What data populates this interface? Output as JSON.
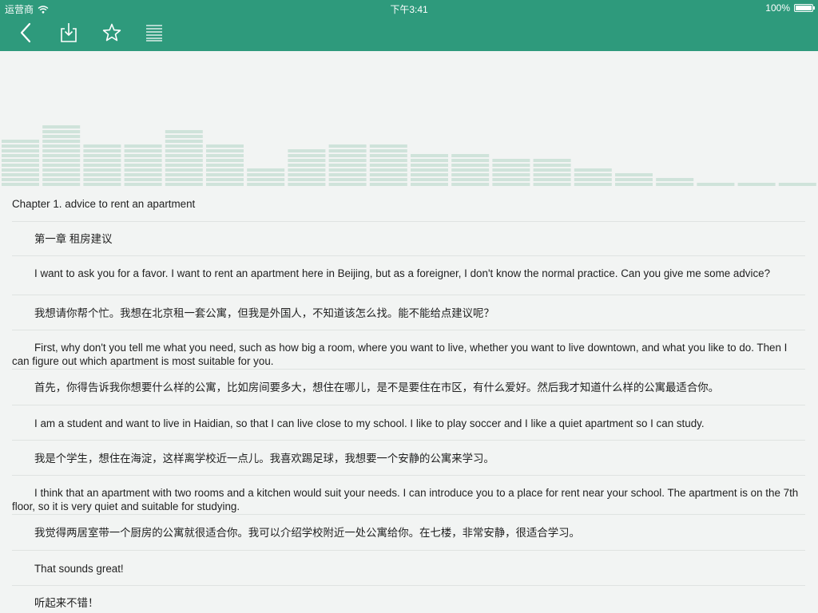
{
  "status_bar": {
    "carrier": "运营商",
    "time": "下午3:41",
    "battery": "100%"
  },
  "toolbar": {
    "back_icon": "back-chevron-icon",
    "download_icon": "download-icon",
    "favorite_icon": "star-icon",
    "menu_icon": "list-icon",
    "accent_color": "#2e9a7c"
  },
  "visualizer": {
    "levels": [
      0.36,
      0.46,
      0.32,
      0.32,
      0.43,
      0.32,
      0.13,
      0.28,
      0.32,
      0.32,
      0.24,
      0.24,
      0.2,
      0.2,
      0.13,
      0.1,
      0.06,
      0.03,
      0.03,
      0.03
    ],
    "color": "#cfe3da"
  },
  "content": {
    "lines": [
      {
        "type": "chapter",
        "text": "Chapter 1. advice to rent an apartment"
      },
      {
        "type": "zh",
        "text": "第一章 租房建议"
      },
      {
        "type": "en",
        "text": "I want to ask you for a favor. I want to rent an apartment here in Beijing, but as a foreigner, I don't know the normal practice. Can you give me some advice?"
      },
      {
        "type": "zh",
        "text": "我想请你帮个忙。我想在北京租一套公寓，但我是外国人，不知道该怎么找。能不能给点建议呢？"
      },
      {
        "type": "en",
        "text": "First, why don't you tell me what you need, such as how big a room, where you want to live, whether you want to live downtown, and what you like to do. Then I can figure out which apartment is most suitable for you."
      },
      {
        "type": "zh",
        "text": "首先，你得告诉我你想要什么样的公寓，比如房间要多大，想住在哪儿，是不是要住在市区，有什么爱好。然后我才知道什么样的公寓最适合你。"
      },
      {
        "type": "en",
        "text": "I am a student and want to live in Haidian, so that I can live close to my school. I like to play soccer and I like a quiet apartment so I can study."
      },
      {
        "type": "zh",
        "text": "我是个学生，想住在海淀，这样离学校近一点儿。我喜欢踢足球，我想要一个安静的公寓来学习。"
      },
      {
        "type": "en",
        "text": "I think that an apartment with two rooms and a kitchen would suit your needs. I can introduce you to a place for rent near your school. The apartment is on the 7th floor, so it is very quiet and suitable for studying."
      },
      {
        "type": "zh",
        "text": "我觉得两居室带一个厨房的公寓就很适合你。我可以介绍学校附近一处公寓给你。在七楼，非常安静，很适合学习。"
      },
      {
        "type": "en",
        "text": "That sounds great!"
      },
      {
        "type": "zh",
        "text": "听起来不错！"
      }
    ]
  }
}
